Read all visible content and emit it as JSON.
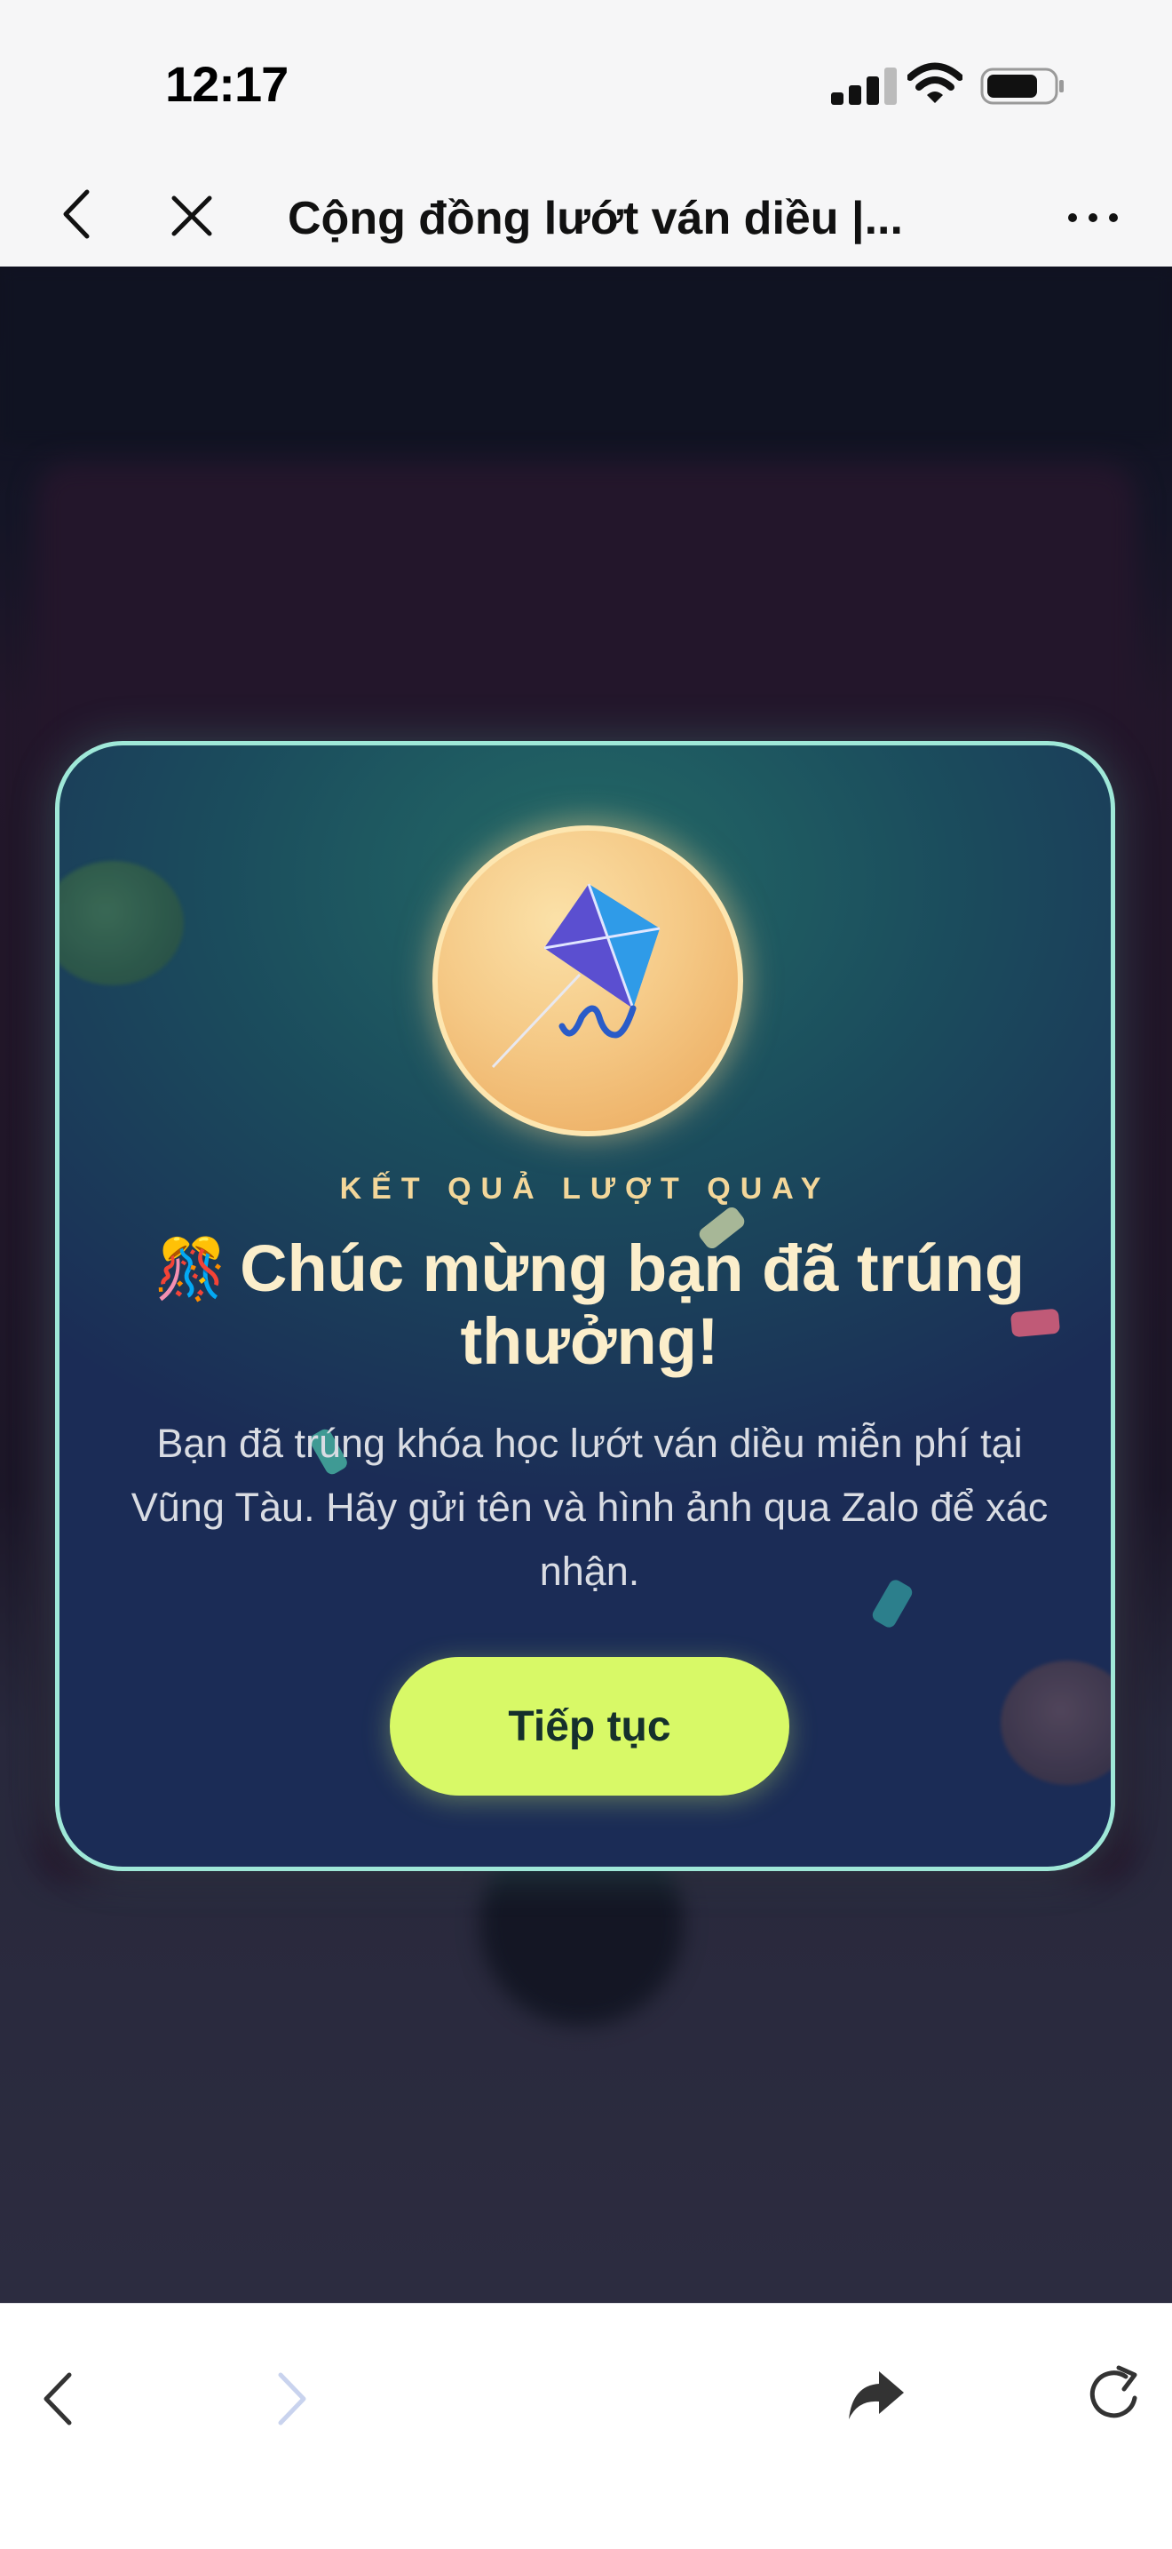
{
  "status_bar": {
    "time": "12:17"
  },
  "nav": {
    "title": "Cộng đồng lướt ván diều |..."
  },
  "modal": {
    "eyebrow": "KẾT QUẢ LƯỢT QUAY",
    "title_emoji": "🎊",
    "title": "Chúc mừng bạn đã trúng thưởng!",
    "description": "Bạn đã trúng khóa học lướt ván diều miễn phí tại Vũng Tàu. Hãy gửi tên và hình ảnh qua Zalo để xác nhận.",
    "button_label": "Tiếp tục",
    "colors": {
      "accent_button": "#d8f967",
      "border": "#9fe8d8",
      "eyebrow": "#f3d79a"
    }
  },
  "icons": {
    "nav": [
      "chevron-left-icon",
      "close-icon",
      "more-icon"
    ],
    "status": [
      "signal-icon",
      "wifi-icon",
      "battery-icon"
    ],
    "toolbar": [
      "back-icon",
      "forward-icon",
      "share-icon",
      "reload-icon"
    ],
    "medal": "kite-icon"
  }
}
